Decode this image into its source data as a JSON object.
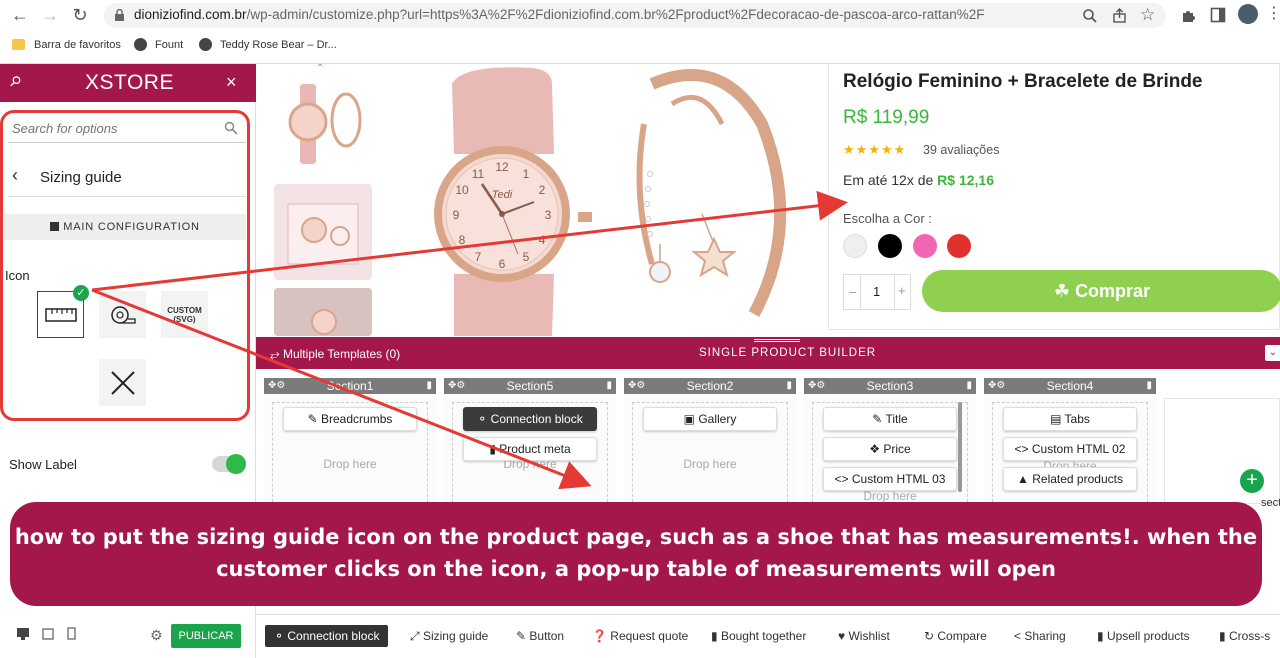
{
  "browser": {
    "url_domain": "dioniziofind.com.br",
    "url_path": "/wp-admin/customize.php?url=https%3A%2F%2Fdioniziofind.com.br%2Fproduct%2Fdecoracao-de-pascoa-arco-rattan%2F",
    "bookmarks": [
      "Barra de favoritos",
      "Fount",
      "Teddy Rose Bear – Dr..."
    ]
  },
  "sidebar": {
    "logo": "XSTORE",
    "search_placeholder": "Search for options",
    "section_title": "Sizing guide",
    "main_config": "MAIN CONFIGURATION",
    "icon_label": "Icon",
    "custom_svg": [
      "CUSTOM",
      "(SVG)"
    ],
    "show_label": "Show Label",
    "show_label_on": true,
    "publish": "PUBLICAR"
  },
  "product": {
    "title": "Relógio Feminino + Bracelete de Brinde",
    "price": "R$ 119,99",
    "rating_stars": 5,
    "reviews": "39 avaliações",
    "installments_prefix": "Em até 12x de",
    "installments_value": "R$ 12,16",
    "color_label": "Escolha a Cor :",
    "colors": [
      "#efefef",
      "#000000",
      "#f165b3",
      "#e0312f"
    ],
    "quantity": "1",
    "qty_minus": "–",
    "qty_plus": "+",
    "buy_label": "Comprar",
    "watch_brand": "Tedi"
  },
  "builder": {
    "multiple_templates": "Multiple Templates (0)",
    "title": "SINGLE PRODUCT BUILDER",
    "drop_here": "Drop here",
    "add_section_partial": "sect",
    "sections": [
      {
        "name": "Section1",
        "blocks": [
          "Breadcrumbs"
        ]
      },
      {
        "name": "Section5",
        "blocks": [
          "Connection block",
          "Product meta"
        ]
      },
      {
        "name": "Section2",
        "blocks": [
          "Gallery"
        ]
      },
      {
        "name": "Section3",
        "blocks": [
          "Title",
          "Price",
          "Custom HTML 03"
        ]
      },
      {
        "name": "Section4",
        "blocks": [
          "Tabs",
          "Custom HTML 02",
          "Related products"
        ]
      }
    ]
  },
  "toolbar": [
    "Connection block",
    "Sizing guide",
    "Button",
    "Request quote",
    "Bought together",
    "Wishlist",
    "Compare",
    "Sharing",
    "Upsell products",
    "Cross-s"
  ],
  "caption": [
    "how to put the sizing guide icon on the product page, such as a shoe that has measurements!. when the",
    "customer clicks on the icon, a pop-up table of measurements will open"
  ],
  "colors": {
    "brand": "#a4174b",
    "accent_green": "#8fd14f",
    "price_green": "#3bb63b",
    "annotation_red": "#e53935"
  }
}
